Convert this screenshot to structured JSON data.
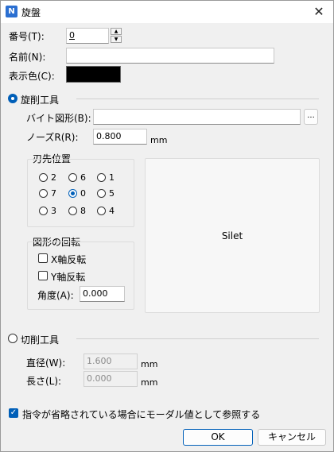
{
  "window": {
    "title": "旋盤",
    "app_icon": "N"
  },
  "fields": {
    "number_label": "番号(T):",
    "number_value": "0",
    "name_label": "名前(N):",
    "name_value": "",
    "color_label": "表示色(C):",
    "color_value": "#000000"
  },
  "lathe_tool": {
    "radio_label": "旋削工具",
    "checked": true,
    "bite_shape_label": "バイト図形(B):",
    "bite_shape_value": "",
    "browse_label": "...",
    "nose_r_label": "ノーズR(R):",
    "nose_r_value": "0.800",
    "nose_r_unit": "mm",
    "tip_position": {
      "title": "刃先位置",
      "selected": "0",
      "options": [
        "2",
        "6",
        "1",
        "7",
        "0",
        "5",
        "3",
        "8",
        "4"
      ]
    },
    "rotation": {
      "title": "図形の回転",
      "x_flip_label": "X軸反転",
      "x_flip_checked": false,
      "y_flip_label": "Y軸反転",
      "y_flip_checked": false,
      "angle_label": "角度(A):",
      "angle_value": "0.000"
    },
    "preview_label": "Silet"
  },
  "cutting_tool": {
    "radio_label": "切削工具",
    "checked": false,
    "diameter_label": "直径(W):",
    "diameter_value": "1.600",
    "diameter_unit": "mm",
    "length_label": "長さ(L):",
    "length_value": "0.000",
    "length_unit": "mm"
  },
  "modal_checkbox": {
    "label": "指令が省略されている場合にモーダル値として参照する",
    "checked": true
  },
  "buttons": {
    "ok": "OK",
    "cancel": "キャンセル"
  },
  "colors": {
    "accent": "#005fb8",
    "display_color": "#000000"
  }
}
